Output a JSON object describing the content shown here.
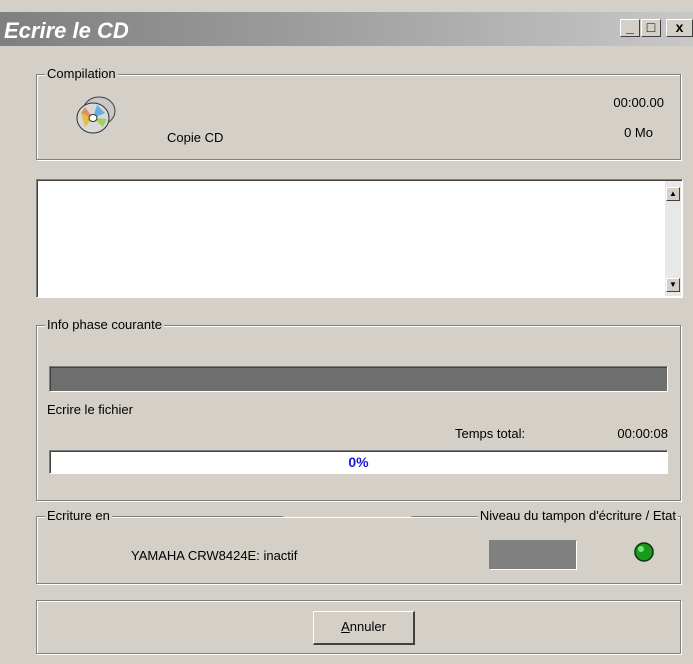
{
  "window": {
    "title": "Ecrire le CD",
    "minimize_glyph": "_",
    "maximize_glyph": "□",
    "close_glyph": "x"
  },
  "compilation": {
    "legend": "Compilation",
    "name": "Copie CD",
    "time": "00:00.00",
    "size": "0 Mo",
    "icon": "cd-icon"
  },
  "log": {
    "lines": []
  },
  "phase": {
    "legend": "Info phase courante",
    "action": "Ecrire le fichier",
    "total_label": "Temps total:",
    "total_time": "00:00:08",
    "phase_progress": 0,
    "total_progress_text": "0%",
    "total_progress": 0
  },
  "writer": {
    "legend": "Ecriture en",
    "buffer_legend": "Niveau du tampon d'écriture / Etat",
    "device": "YAMAHA CRW8424E: inactif",
    "status_color": "#1a9a1a"
  },
  "footer": {
    "cancel_label_prefix": "A",
    "cancel_label_rest": "nnuler"
  }
}
